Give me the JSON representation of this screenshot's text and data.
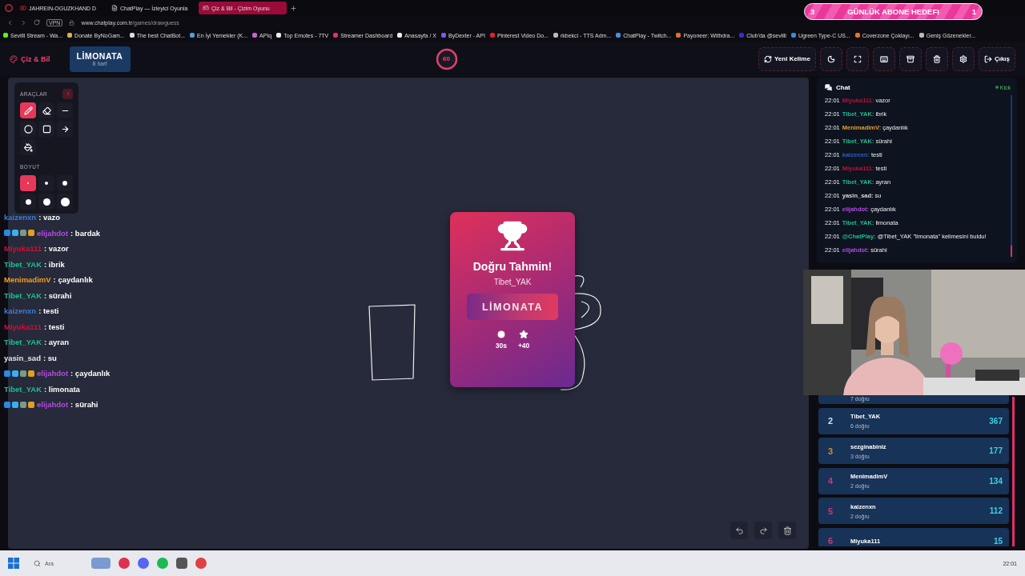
{
  "browser": {
    "tabs": [
      {
        "label": "JAHREIN-OGUZKHAND D",
        "kind": "video",
        "selected": false
      },
      {
        "label": "ChatPlay — İzleyici Oyunla",
        "kind": "page",
        "selected": false
      },
      {
        "label": "Çiz & Bil - Çizim Oyunu",
        "kind": "game",
        "selected": true
      }
    ],
    "vpn": "VPN",
    "url_host": "www.chatplay.com.tr",
    "url_path": "/games/drawguess",
    "bookmarks": [
      {
        "label": "Sevilli Stream - Wa...",
        "color": "#53fc18"
      },
      {
        "label": "Donate ByNoGam...",
        "color": "#e0b040"
      },
      {
        "label": "The best ChatBot...",
        "color": "#dddddd"
      },
      {
        "label": "En İyi Yemekler (K...",
        "color": "#4aa0e0"
      },
      {
        "label": "APIq",
        "color": "#d060d0"
      },
      {
        "label": "Top Emotes - 7TV",
        "color": "#eeeeee"
      },
      {
        "label": "Streamer Dashboard",
        "color": "#e0306a"
      },
      {
        "label": "Anasayfa / X",
        "color": "#eeeeee"
      },
      {
        "label": "ByDexter - API",
        "color": "#7a5af0"
      },
      {
        "label": "Pinterest Video Do...",
        "color": "#e02030"
      },
      {
        "label": "rkbekci - TTS Adm...",
        "color": "#bbbbbb"
      },
      {
        "label": "ChatPlay - Twitch...",
        "color": "#4a90e0"
      },
      {
        "label": "Payoneer: Withdra...",
        "color": "#e07030"
      },
      {
        "label": "Club'da @sevilli",
        "color": "#3a2ad0"
      },
      {
        "label": "Ugreen Type-C US...",
        "color": "#3a8ae0"
      },
      {
        "label": "Coverzone Çoklayı...",
        "color": "#f07020"
      },
      {
        "label": "Geniş Gözenekler...",
        "color": "#bbbbbb"
      }
    ]
  },
  "sub_goal": {
    "current": "3",
    "title": "GÜNLÜK ABONE HEDEFI",
    "target": "1"
  },
  "header": {
    "logo": "Çiz & Bil",
    "word": "LİMONATA",
    "word_hint": "8 harf",
    "timer": "60",
    "buttons": [
      {
        "kind": "refresh",
        "label": "Yeni Kelime"
      },
      {
        "kind": "moon"
      },
      {
        "kind": "fullscreen"
      },
      {
        "kind": "keyboard"
      },
      {
        "kind": "archive"
      },
      {
        "kind": "trash"
      },
      {
        "kind": "settings"
      },
      {
        "kind": "exit",
        "label": "Çıkış"
      }
    ]
  },
  "tools": {
    "title": "ARAÇLAR",
    "items": [
      {
        "kind": "pen",
        "selected": true
      },
      {
        "kind": "eraser",
        "selected": false
      },
      {
        "kind": "line",
        "selected": false
      },
      {
        "kind": "circle",
        "selected": false
      },
      {
        "kind": "square",
        "selected": false
      },
      {
        "kind": "arrow",
        "selected": false
      },
      {
        "kind": "fill",
        "selected": false
      }
    ],
    "size_title": "BOYUT",
    "sizes": [
      {
        "selected": true
      },
      {
        "selected": false
      },
      {
        "selected": false
      },
      {
        "selected": false
      },
      {
        "selected": false
      },
      {
        "selected": false
      }
    ]
  },
  "result": {
    "title": "Doğru Tahmin!",
    "player": "Tibet_YAK",
    "word": "LİMONATA",
    "time": "30s",
    "points": "+40"
  },
  "overlay_chat": [
    {
      "user": "kaizenxn",
      "color": "#3a7bd5",
      "text": ": vazo",
      "badges": false
    },
    {
      "user": "elijahdot",
      "color": "#b44be1",
      "text": ": bardak",
      "badges": true
    },
    {
      "user": "Miyuka111",
      "color": "#d0103a",
      "text": ": vazor",
      "badges": false
    },
    {
      "user": "Tibet_YAK",
      "color": "#1fbf8f",
      "text": ": ibrik",
      "badges": false
    },
    {
      "user": "MenimadimV",
      "color": "#f0a020",
      "text": ": çaydanlık",
      "badges": false
    },
    {
      "user": "Tibet_YAK",
      "color": "#1fbf8f",
      "text": ": sürahi",
      "badges": false
    },
    {
      "user": "kaizenxn",
      "color": "#3a7bd5",
      "text": ": testi",
      "badges": false
    },
    {
      "user": "Miyuka111",
      "color": "#d0103a",
      "text": ": testi",
      "badges": false
    },
    {
      "user": "Tibet_YAK",
      "color": "#1fbf8f",
      "text": ": ayran",
      "badges": false
    },
    {
      "user": "yasin_sad",
      "color": "#e6e6e6",
      "text": ": su",
      "badges": false
    },
    {
      "user": "elijahdot",
      "color": "#b44be1",
      "text": ": çaydanlık",
      "badges": true
    },
    {
      "user": "Tibet_YAK",
      "color": "#1fbf8f",
      "text": ": limonata",
      "badges": false
    },
    {
      "user": "elijahdot",
      "color": "#b44be1",
      "text": ": sürahi",
      "badges": true
    }
  ],
  "chat": {
    "title": "Chat",
    "source": "Kick",
    "messages": [
      {
        "time": "22:01",
        "user": "Miyuka111:",
        "color": "#c0103a",
        "text": "vazor"
      },
      {
        "time": "22:01",
        "user": "Tibet_YAK:",
        "color": "#1fbf8f",
        "text": "ibrik"
      },
      {
        "time": "22:01",
        "user": "MenimadimV:",
        "color": "#e0a030",
        "text": "çaydanlık"
      },
      {
        "time": "22:01",
        "user": "Tibet_YAK:",
        "color": "#1fbf8f",
        "text": "sürahi"
      },
      {
        "time": "22:01",
        "user": "kaizenxn:",
        "color": "#2a60c0",
        "text": "testi"
      },
      {
        "time": "22:01",
        "user": "Miyuka111:",
        "color": "#c0103a",
        "text": "testi"
      },
      {
        "time": "22:01",
        "user": "Tibet_YAK:",
        "color": "#1fbf8f",
        "text": "ayran"
      },
      {
        "time": "22:01",
        "user": "yasin_sad:",
        "color": "#d8d8d8",
        "text": "su"
      },
      {
        "time": "22:01",
        "user": "elijahdot:",
        "color": "#b44be1",
        "text": "çaydanlık"
      },
      {
        "time": "22:01",
        "user": "Tibet_YAK:",
        "color": "#1fbf8f",
        "text": "limonata"
      },
      {
        "time": "22:01",
        "user": "@ChatPlay:",
        "color": "#1fbf8f",
        "text": "@Tibet_YAK \"limonata\" kelimesini buldu!"
      },
      {
        "time": "22:01",
        "user": "elijahdot:",
        "color": "#b44be1",
        "text": "sürahi"
      }
    ]
  },
  "leaderboard": [
    {
      "sub": "7 doğru"
    },
    {
      "rank": "2",
      "name": "Tibet_YAK",
      "sub": "6 doğru",
      "score": "367",
      "color": "#d8dde8"
    },
    {
      "rank": "3",
      "name": "sezginabiniz",
      "sub": "3 doğru",
      "score": "177",
      "color": "#d98a3a"
    },
    {
      "rank": "4",
      "name": "MenimadimV",
      "sub": "2 doğru",
      "score": "134",
      "color": "#e0306a"
    },
    {
      "rank": "5",
      "name": "kaizenxn",
      "sub": "2 doğru",
      "score": "112",
      "color": "#e0306a"
    },
    {
      "rank": "6",
      "name": "Miyuka111",
      "score": "15",
      "color": "#e0306a"
    }
  ],
  "taskbar": {
    "search": "Ara",
    "time": "22:01"
  }
}
